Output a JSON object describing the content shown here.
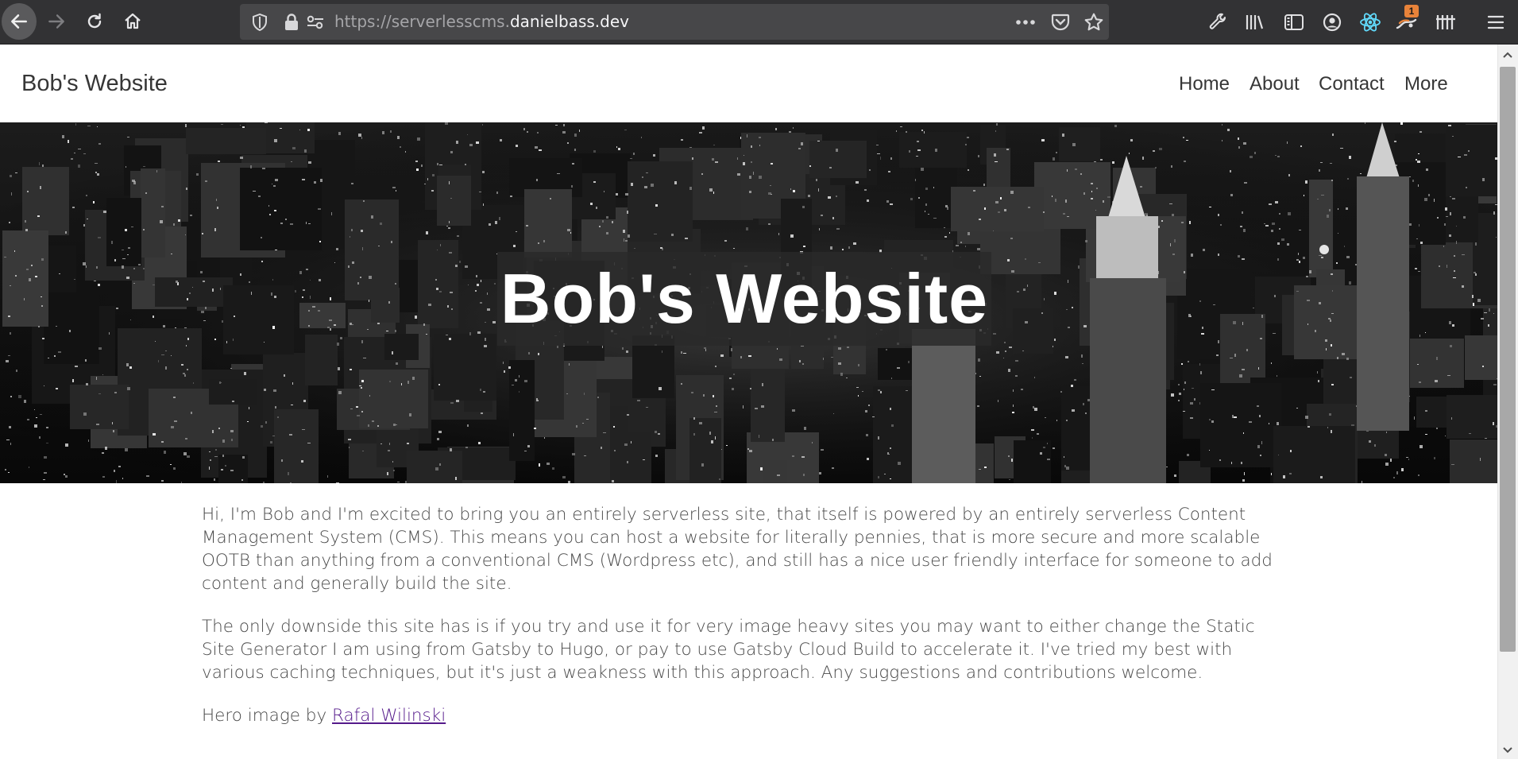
{
  "browser": {
    "url_prefix": "https://serverlesscms.",
    "url_domain": "danielbass.dev",
    "extension_badge": "1",
    "icons": [
      "back-icon",
      "forward-icon",
      "reload-icon",
      "home-icon",
      "shield-icon",
      "lock-icon",
      "permissions-icon",
      "more-actions-icon",
      "pocket-icon",
      "bookmark-star-icon",
      "wrench-icon",
      "library-icon",
      "sidebar-icon",
      "account-icon",
      "react-devtools-icon",
      "extension-icon",
      "tiles-icon",
      "menu-icon"
    ]
  },
  "site": {
    "brand": "Bob's Website",
    "nav": [
      "Home",
      "About",
      "Contact",
      "More"
    ],
    "hero_title": "Bob's Website"
  },
  "content": {
    "para1": "Hi, I'm Bob and I'm excited to bring you an entirely serverless site, that itself is powered by an entirely serverless Content Management System (CMS). This means you can host a website for literally pennies, that is more secure and more scalable OOTB than anything from a conventional CMS (Wordpress etc), and still has a nice user friendly interface for someone to add content and generally build the site.",
    "para2": "The only downside this site has is if you try and use it for very image heavy sites you may want to either change the Static Site Generator I am using from Gatsby to Hugo, or pay to use Gatsby Cloud Build to accelerate it. I've tried my best with various caching techniques, but it's just a weakness with this approach. Any suggestions and contributions welcome.",
    "credit_prefix": "Hero image by ",
    "credit_link": "Rafal Wilinski"
  }
}
